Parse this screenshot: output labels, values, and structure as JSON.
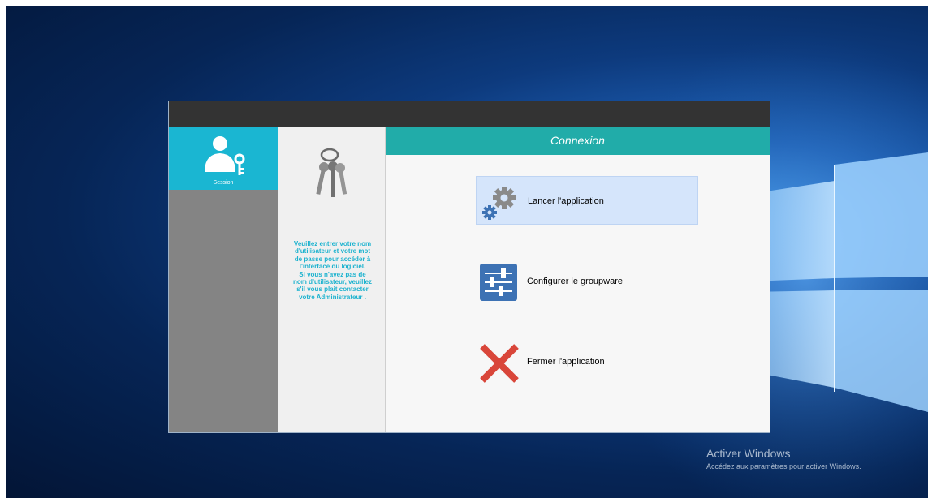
{
  "desktop": {
    "activation_title": "Activer Windows",
    "activation_subtitle": "Accédez aux paramètres pour activer Windows."
  },
  "sidebar": {
    "session_label": "Session",
    "icon": "user-key-icon"
  },
  "instructions": {
    "icon": "keys-icon",
    "lines": [
      "Veuillez entrer votre nom",
      "d'utilisateur et votre mot",
      "de passe pour accéder à",
      "l'interface du logiciel.",
      "Si vous n'avez pas de",
      "nom d'utilisateur, veuillez",
      "s'il vous plait contacter",
      "votre Administrateur ."
    ]
  },
  "panel": {
    "header": "Connexion",
    "actions": [
      {
        "label": "Lancer l'application",
        "icon": "gears-icon",
        "highlighted": true
      },
      {
        "label": "Configurer le groupware",
        "icon": "sliders-icon",
        "highlighted": false
      },
      {
        "label": "Fermer l'application",
        "icon": "close-x-icon",
        "highlighted": false
      }
    ]
  },
  "colors": {
    "accent_teal": "#21aca9",
    "session_cyan": "#1ab6d2",
    "text_cyan": "#1eb3cf",
    "close_red": "#d9463a",
    "icon_blue": "#3d72b4",
    "highlight": "#d5e5fb"
  }
}
